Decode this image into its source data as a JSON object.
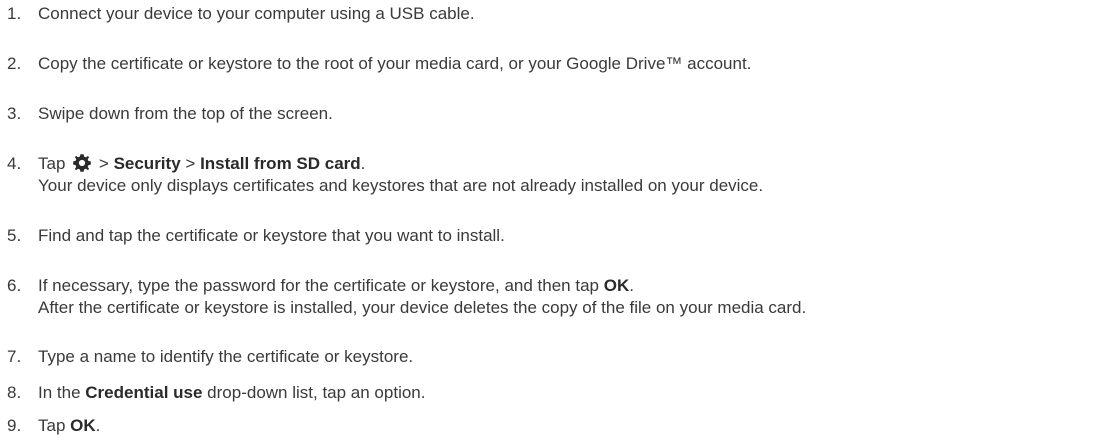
{
  "steps": [
    {
      "number": "1.",
      "text": "Connect your device to your computer using a USB cable."
    },
    {
      "number": "2.",
      "text": "Copy the certificate or keystore to the root of your media card, or your Google Drive™ account."
    },
    {
      "number": "3.",
      "text": "Swipe down from the top of the screen."
    },
    {
      "number": "4.",
      "prefix": "Tap",
      "icon": "gear-icon",
      "sep1": ">",
      "security": "Security",
      "sep2": ">",
      "install": "Install from SD card",
      "period": ".",
      "note": "Your device only displays certificates and keystores that are not already installed on your device."
    },
    {
      "number": "5.",
      "text": "Find and tap the certificate or keystore that you want to install."
    },
    {
      "number": "6.",
      "text_before": "If necessary, type the password for the certificate or keystore, and then tap",
      "ok": "OK",
      "period": ".",
      "note": "After the certificate or keystore is installed, your device deletes the copy of the file on your media card."
    },
    {
      "number": "7.",
      "text": "Type a name to identify the certificate or keystore."
    },
    {
      "number": "8.",
      "text_before": "In the",
      "bold": "Credential use",
      "text_after": "drop-down list, tap an option."
    },
    {
      "number": "9.",
      "text_before": "Tap",
      "ok": "OK",
      "period": "."
    }
  ]
}
